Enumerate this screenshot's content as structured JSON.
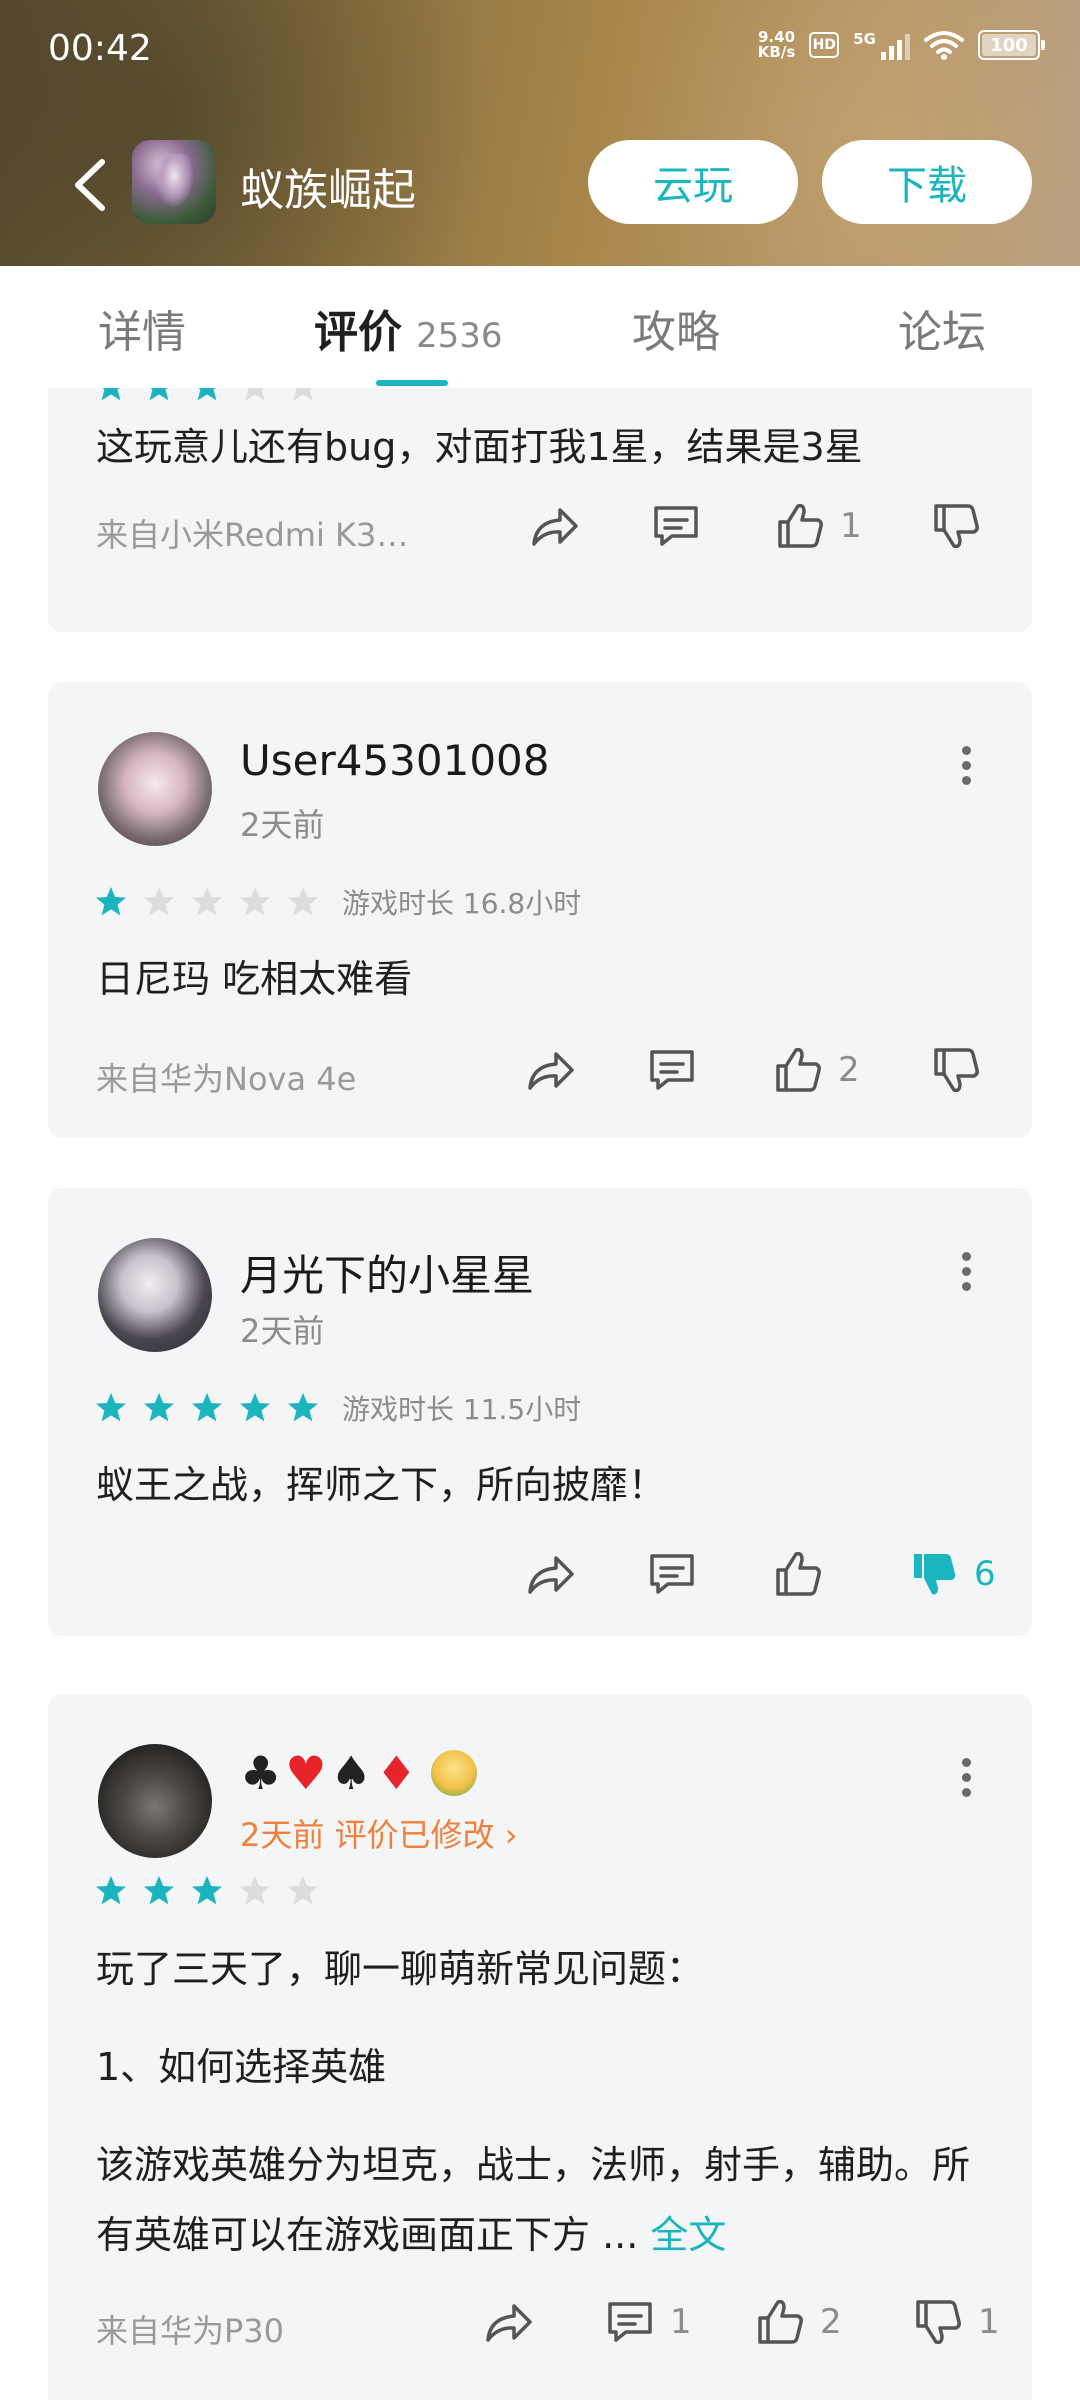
{
  "status_bar": {
    "time": "00:42",
    "net_speed_value": "9.40",
    "net_speed_unit": "KB/s",
    "hd": "HD",
    "network": "5G",
    "battery": "100"
  },
  "app_bar": {
    "title": "蚁族崛起",
    "cloud_play_label": "云玩",
    "download_label": "下载"
  },
  "tabs": [
    {
      "label": "详情"
    },
    {
      "label": "评价",
      "count": "2536"
    },
    {
      "label": "攻略"
    },
    {
      "label": "论坛"
    }
  ],
  "colors": {
    "accent": "#1ab5bf",
    "star_on": "#1ab5bf",
    "star_off": "#dcdcdc",
    "modified_text": "#f0803c"
  },
  "reviews": [
    {
      "rating": 3,
      "content": "这玩意儿还有bug，对面打我1星，结果是3星",
      "source": "来自小米Redmi K3…",
      "likes": "1"
    },
    {
      "username": "User45301008",
      "time": "2天前",
      "rating": 1,
      "playtime": "游戏时长 16.8小时",
      "content": "日尼玛 吃相太难看",
      "source": "来自华为Nova 4e",
      "likes": "2"
    },
    {
      "username": "月光下的小星星",
      "time": "2天前",
      "rating": 5,
      "playtime": "游戏时长 11.5小时",
      "content": "蚁王之战，挥师之下，所向披靡！",
      "dislikes": "6"
    },
    {
      "username_symbols": [
        "♣",
        "♥",
        "♠",
        "♦"
      ],
      "time_modified": "2天前 评价已修改",
      "rating": 3,
      "content_lines": [
        "玩了三天了，聊一聊萌新常见问题：",
        "1、如何选择英雄",
        "该游戏英雄分为坦克，战士，法师，射手，辅助。所有英雄可以在游戏画面正下方 ..."
      ],
      "full_text_label": "全文",
      "source": "来自华为P30",
      "comments": "1",
      "likes": "2",
      "dislikes": "1"
    }
  ]
}
